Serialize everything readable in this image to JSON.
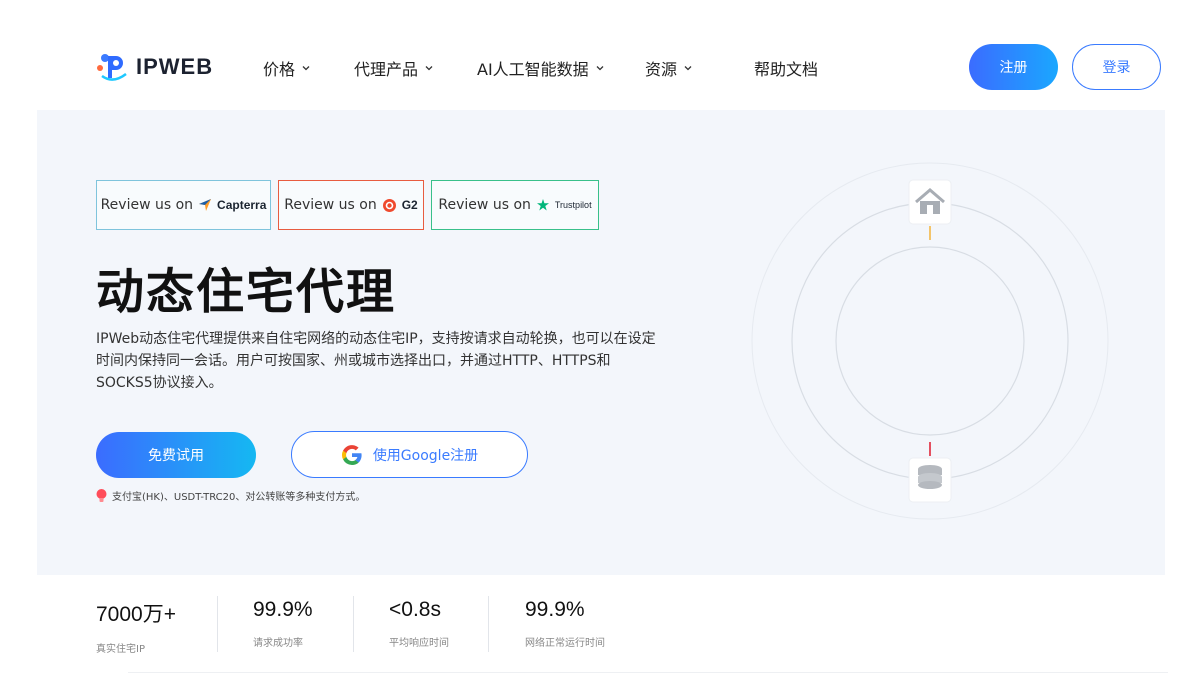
{
  "header": {
    "logo_text": "IPWEB",
    "nav": [
      {
        "label": "价格",
        "has_dropdown": true
      },
      {
        "label": "代理产品",
        "has_dropdown": true
      },
      {
        "label": "AI人工智能数据",
        "has_dropdown": true
      },
      {
        "label": "资源",
        "has_dropdown": true
      },
      {
        "label": "帮助文档",
        "has_dropdown": false
      }
    ],
    "register_label": "注册",
    "login_label": "登录"
  },
  "hero": {
    "reviews": [
      {
        "prefix": "Review us on",
        "brand": "Capterra"
      },
      {
        "prefix": "Review us on",
        "brand": "G2"
      },
      {
        "prefix": "Review us on",
        "brand": "Trustpilot"
      }
    ],
    "title": "动态住宅代理",
    "description": "IPWeb动态住宅代理提供来自住宅网络的动态住宅IP，支持按请求自动轮换，也可以在设定时间内保持同一会话。用户可按国家、州或城市选择出口，并通过HTTP、HTTPS和SOCKS5协议接入。",
    "trial_label": "免费试用",
    "google_label": "使用Google注册",
    "payment_note": "支付宝(HK)、USDT-TRC20、对公转账等多种支付方式。"
  },
  "stats": [
    {
      "value": "7000万+",
      "label": "真实住宅IP"
    },
    {
      "value": "99.9%",
      "label": "请求成功率"
    },
    {
      "value": "<0.8s",
      "label": "平均响应时间"
    },
    {
      "value": "99.9%",
      "label": "网络正常运行时间"
    }
  ],
  "colors": {
    "primary": "#3a7bff",
    "gradient_start": "#3b6cff",
    "gradient_end": "#1aa7ff",
    "hero_bg": "#f3f6fb"
  }
}
